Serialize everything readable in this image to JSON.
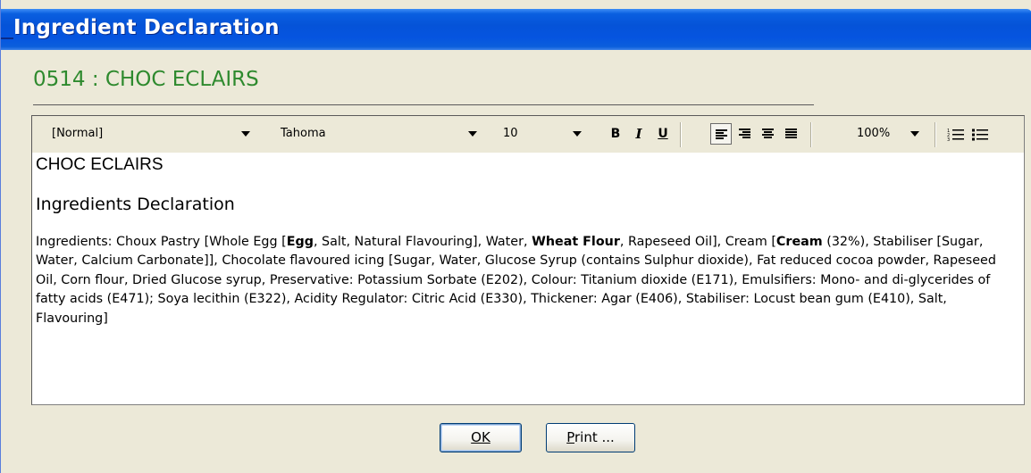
{
  "window": {
    "title": "Ingredient Declaration"
  },
  "product": {
    "heading": "0514 : CHOC ECLAIRS"
  },
  "toolbar": {
    "style": "[Normal]",
    "font": "Tahoma",
    "size": "10",
    "bold": "B",
    "italic": "I",
    "underline": "U",
    "zoom": "100%",
    "active_alignment": "left"
  },
  "document": {
    "title": "CHOC ECLAIRS",
    "subtitle": "Ingredients Declaration",
    "body": [
      {
        "text": "Ingredients: Choux Pastry [Whole Egg [",
        "bold": false
      },
      {
        "text": "Egg",
        "bold": true
      },
      {
        "text": ", Salt, Natural Flavouring], Water, ",
        "bold": false
      },
      {
        "text": "Wheat Flour",
        "bold": true
      },
      {
        "text": ", Rapeseed Oil], Cream [",
        "bold": false
      },
      {
        "text": "Cream",
        "bold": true
      },
      {
        "text": " (32%), Stabiliser [Sugar, Water, Calcium Carbonate]], Chocolate flavoured icing [Sugar, Water, Glucose Syrup (contains Sulphur dioxide), Fat reduced cocoa powder, Rapeseed Oil, Corn flour, Dried Glucose syrup, Preservative: Potassium Sorbate (E202), Colour: Titanium dioxide (E171), Emulsifiers: Mono- and di-glycerides of fatty acids (E471); Soya lecithin (E322), Acidity Regulator: Citric Acid (E330), Thickener: Agar (E406), Stabiliser: Locust bean gum (E410), Salt, Flavouring]",
        "bold": false
      }
    ]
  },
  "buttons": {
    "ok": "OK",
    "print_first": "P",
    "print_rest": "rint ..."
  },
  "colors": {
    "title_bar": "#0553d8",
    "heading": "#2e8a2e",
    "dialog_bg": "#ece9d8"
  }
}
